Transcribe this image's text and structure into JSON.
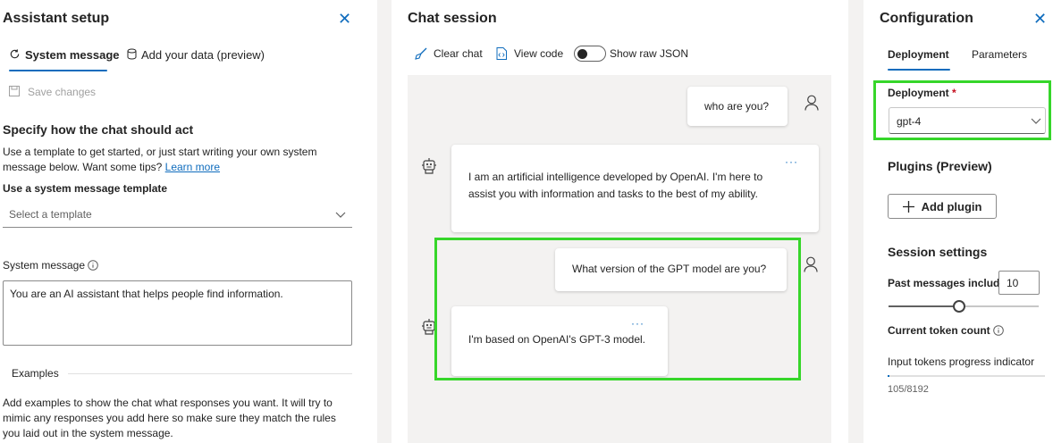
{
  "left": {
    "title": "Assistant setup",
    "tabs": [
      "System message",
      "Add your data (preview)"
    ],
    "save_label": "Save changes",
    "heading": "Specify how the chat should act",
    "intro_text": "Use a template to get started, or just start writing your own system message below. Want some tips?",
    "learn_more": "Learn more",
    "template_label": "Use a system message template",
    "template_placeholder": "Select a template",
    "system_message_label": "System message",
    "system_message_value": "You are an AI assistant that helps people find information.",
    "examples_label": "Examples",
    "examples_text": "Add examples to show the chat what responses you want. It will try to mimic any responses you add here so make sure they match the rules you laid out in the system message."
  },
  "center": {
    "title": "Chat session",
    "toolbar": {
      "clear": "Clear chat",
      "view_code": "View code",
      "raw_json": "Show raw JSON"
    },
    "raw_json_on": false,
    "messages": [
      {
        "role": "user",
        "text": "who are you?"
      },
      {
        "role": "assistant",
        "text": "I am an artificial intelligence developed by OpenAI. I'm here to assist you with information and tasks to the best of my ability."
      },
      {
        "role": "user",
        "text": "What version of the GPT model are you?"
      },
      {
        "role": "assistant",
        "text": "I'm based on OpenAI's GPT-3 model."
      }
    ],
    "more_glyph": "···"
  },
  "right": {
    "title": "Configuration",
    "tabs": [
      "Deployment",
      "Parameters"
    ],
    "deployment_label": "Deployment",
    "required_mark": "*",
    "deployment_value": "gpt-4",
    "plugins_heading": "Plugins (Preview)",
    "add_plugin": "Add plugin",
    "session_heading": "Session settings",
    "past_messages_label": "Past messages include",
    "past_messages_value": "10",
    "token_count_label": "Current token count",
    "progress_label": "Input tokens progress indicator",
    "token_usage": "105/8192",
    "token_fraction": 0.0128
  },
  "colors": {
    "accent": "#0f6cbd",
    "highlight": "#36d62a"
  },
  "icons": [
    "close-icon",
    "refresh-icon",
    "database-icon",
    "save-icon",
    "chevron-down-icon",
    "info-icon",
    "broom-icon",
    "code-icon",
    "user-icon",
    "bot-icon",
    "plus-icon"
  ]
}
